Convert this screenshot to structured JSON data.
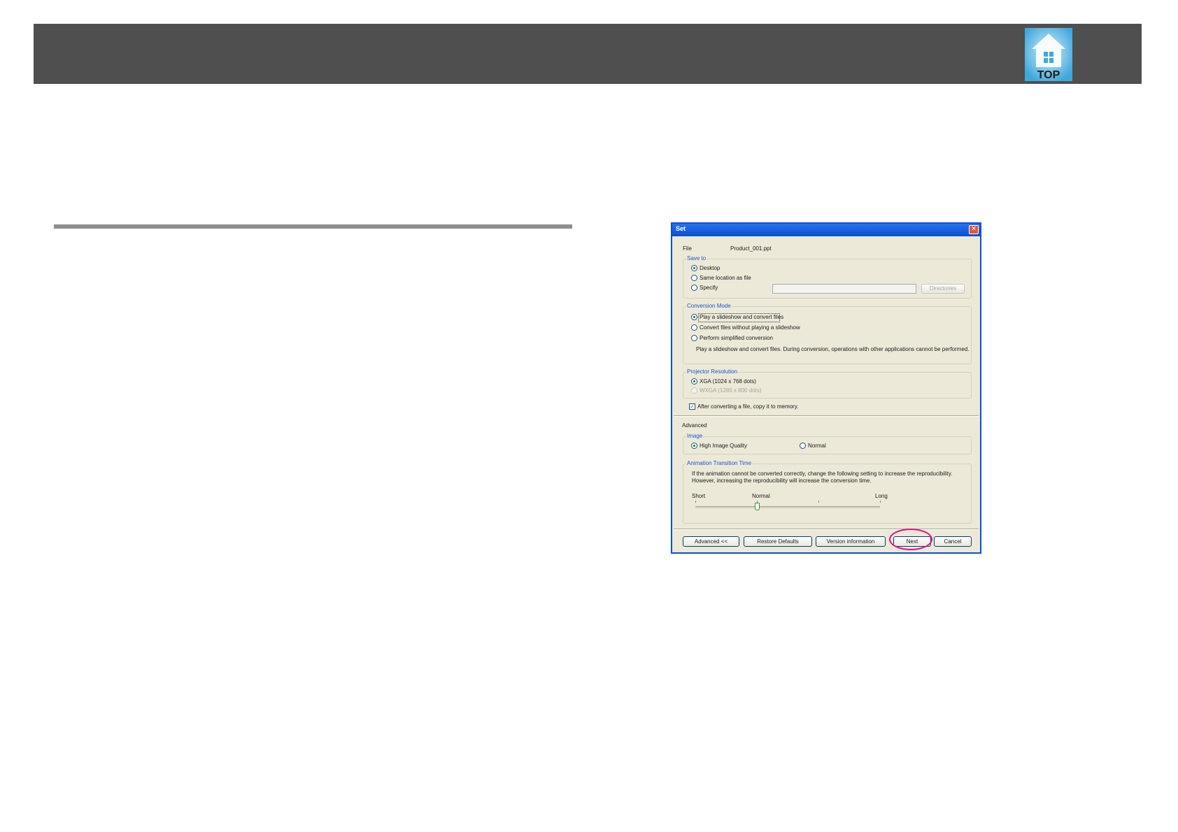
{
  "header": {
    "logo_label": "TOP"
  },
  "dialog": {
    "title": "Set",
    "file_label": "File",
    "file_value": "Product_001.ppt",
    "save_to": {
      "legend": "Save to",
      "options": [
        "Desktop",
        "Same location as file",
        "Specify"
      ],
      "selected": "Desktop",
      "path_value": "",
      "directories_button": "Directories"
    },
    "conversion_mode": {
      "legend": "Conversion Mode",
      "options": [
        "Play a slideshow and convert files",
        "Convert files without playing a slideshow",
        "Perform simplified conversion"
      ],
      "selected": "Play a slideshow and convert files",
      "description": "Play a slideshow and convert files. During conversion, operations with other applications cannot be performed."
    },
    "projector_resolution": {
      "legend": "Projector Resolution",
      "options": [
        "XGA (1024 x 768 dots)",
        "WXGA (1280 x 800 dots)"
      ],
      "selected": "XGA (1024 x 768 dots)"
    },
    "copy_to_memory": {
      "label": "After converting a file, copy it to memory.",
      "checked": true
    },
    "advanced_label": "Advanced",
    "image": {
      "legend": "Image",
      "options": [
        "High Image Quality",
        "Normal"
      ],
      "selected": "High Image Quality"
    },
    "animation": {
      "legend": "Animation Transition Time",
      "description_line1": "If the animation cannot be converted correctly, change the following setting to increase the reproducibility.",
      "description_line2": "However, increasing the reproducibility will increase the conversion time.",
      "scale_labels": [
        "Short",
        "Normal",
        "Long"
      ],
      "slider_value": "Normal"
    },
    "buttons": {
      "advanced": "Advanced <<",
      "restore": "Restore Defaults",
      "version": "Version information",
      "next": "Next",
      "cancel": "Cancel"
    }
  },
  "colors": {
    "header_bar": "#4f4f4f",
    "titlebar": "#0a4fd2",
    "highlight": "#d6168a"
  }
}
